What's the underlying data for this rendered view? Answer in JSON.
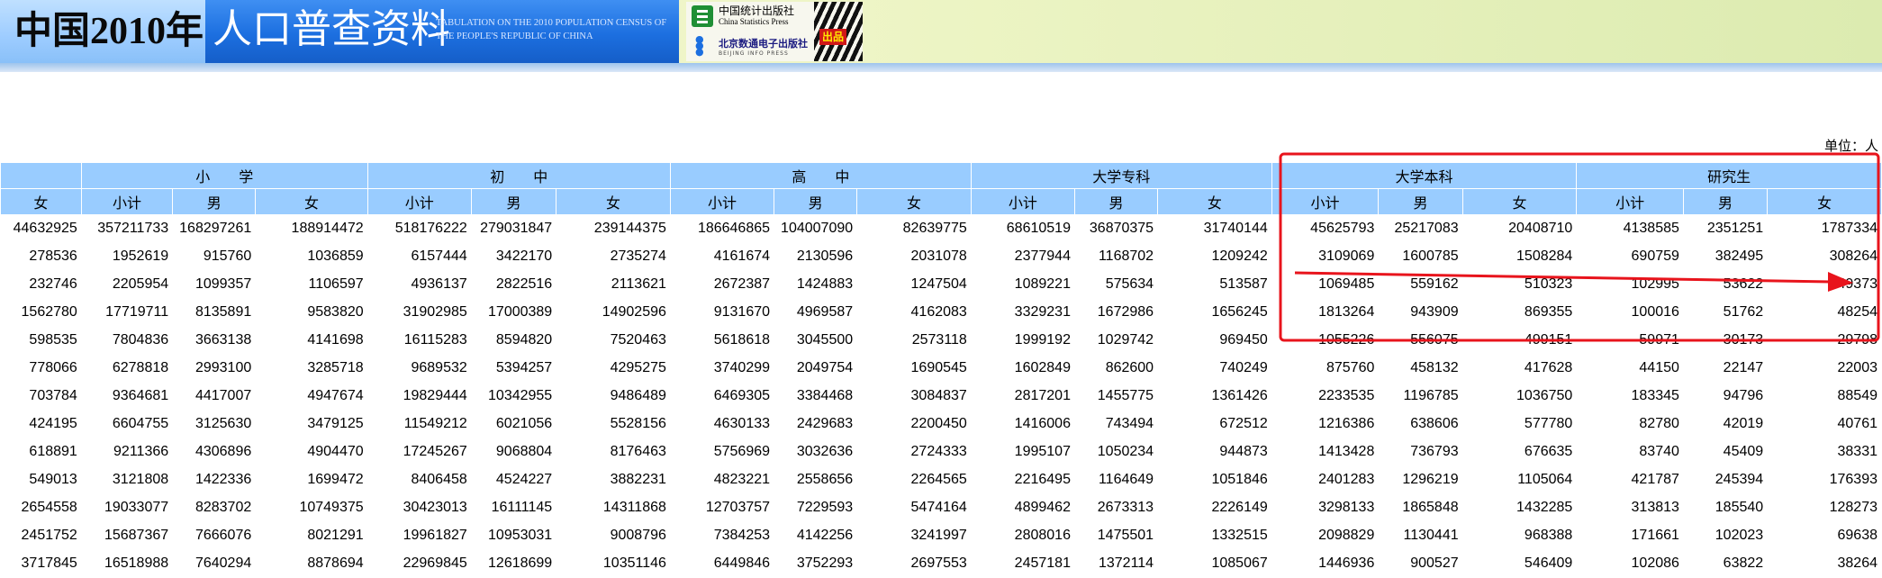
{
  "header": {
    "title_left": "中国2010年",
    "title_main": "人口普查资料",
    "subtitle_line1": "TABULATION ON THE 2010 POPULATION CENSUS OF",
    "subtitle_line2": "THE PEOPLE'S REPUBLIC OF CHINA",
    "logo": {
      "publisher_cn": "中国统计出版社",
      "publisher_en": "China Statistics Press",
      "digital_cn": "北京数通电子出版社",
      "digital_en": "BEIJING INFO PRESS",
      "badge": "出品"
    }
  },
  "unit_label": "单位：人",
  "table": {
    "group_headers": [
      "",
      "小　　学",
      "初　　中",
      "高　　中",
      "大学专科",
      "大学本科",
      "研究生"
    ],
    "sub_headers": [
      "女",
      "小计",
      "男",
      "女",
      "小计",
      "男",
      "女",
      "小计",
      "男",
      "女",
      "小计",
      "男",
      "女",
      "小计",
      "男",
      "女",
      "小计",
      "男",
      "女"
    ],
    "rows": [
      [
        "44632925",
        "357211733",
        "168297261",
        "188914472",
        "518176222",
        "279031847",
        "239144375",
        "186646865",
        "104007090",
        "82639775",
        "68610519",
        "36870375",
        "31740144",
        "45625793",
        "25217083",
        "20408710",
        "4138585",
        "2351251",
        "1787334"
      ],
      [
        "278536",
        "1952619",
        "915760",
        "1036859",
        "6157444",
        "3422170",
        "2735274",
        "4161674",
        "2130596",
        "2031078",
        "2377944",
        "1168702",
        "1209242",
        "3109069",
        "1600785",
        "1508284",
        "690759",
        "382495",
        "308264"
      ],
      [
        "232746",
        "2205954",
        "1099357",
        "1106597",
        "4936137",
        "2822516",
        "2113621",
        "2672387",
        "1424883",
        "1247504",
        "1089221",
        "575634",
        "513587",
        "1069485",
        "559162",
        "510323",
        "102995",
        "53622",
        "49373"
      ],
      [
        "1562780",
        "17719711",
        "8135891",
        "9583820",
        "31902985",
        "17000389",
        "14902596",
        "9131670",
        "4969587",
        "4162083",
        "3329231",
        "1672986",
        "1656245",
        "1813264",
        "943909",
        "869355",
        "100016",
        "51762",
        "48254"
      ],
      [
        "598535",
        "7804836",
        "3663138",
        "4141698",
        "16115283",
        "8594820",
        "7520463",
        "5618618",
        "3045500",
        "2573118",
        "1999192",
        "1029742",
        "969450",
        "1055226",
        "556075",
        "499151",
        "59971",
        "30173",
        "29798"
      ],
      [
        "778066",
        "6278818",
        "2993100",
        "3285718",
        "9689532",
        "5394257",
        "4295275",
        "3740299",
        "2049754",
        "1690545",
        "1602849",
        "862600",
        "740249",
        "875760",
        "458132",
        "417628",
        "44150",
        "22147",
        "22003"
      ],
      [
        "703784",
        "9364681",
        "4417007",
        "4947674",
        "19829444",
        "10342955",
        "9486489",
        "6469305",
        "3384468",
        "3084837",
        "2817201",
        "1455775",
        "1361426",
        "2233535",
        "1196785",
        "1036750",
        "183345",
        "94796",
        "88549"
      ],
      [
        "424195",
        "6604755",
        "3125630",
        "3479125",
        "11549212",
        "6021056",
        "5528156",
        "4630133",
        "2429683",
        "2200450",
        "1416006",
        "743494",
        "672512",
        "1216386",
        "638606",
        "577780",
        "82780",
        "42019",
        "40761"
      ],
      [
        "618891",
        "9211366",
        "4306896",
        "4904470",
        "17245267",
        "9068804",
        "8176463",
        "5756969",
        "3032636",
        "2724333",
        "1995107",
        "1050234",
        "944873",
        "1413428",
        "736793",
        "676635",
        "83740",
        "45409",
        "38331"
      ],
      [
        "549013",
        "3121808",
        "1422336",
        "1699472",
        "8406458",
        "4524227",
        "3882231",
        "4823221",
        "2558656",
        "2264565",
        "2216495",
        "1164649",
        "1051846",
        "2401283",
        "1296219",
        "1105064",
        "421787",
        "245394",
        "176393"
      ],
      [
        "2654558",
        "19033077",
        "8283702",
        "10749375",
        "30423013",
        "16111145",
        "14311868",
        "12703757",
        "7229593",
        "5474164",
        "4899462",
        "2673313",
        "2226149",
        "3298133",
        "1865848",
        "1432285",
        "313813",
        "185540",
        "128273"
      ],
      [
        "2451752",
        "15687367",
        "7666076",
        "8021291",
        "19961827",
        "10953031",
        "9008796",
        "7384253",
        "4142256",
        "3241997",
        "2808016",
        "1475501",
        "1332515",
        "2098829",
        "1130441",
        "968388",
        "171661",
        "102023",
        "69638"
      ],
      [
        "3717845",
        "16518988",
        "7640294",
        "8878694",
        "22969845",
        "12618699",
        "10351146",
        "6449846",
        "3752293",
        "2697553",
        "2457181",
        "1372114",
        "1085067",
        "1446936",
        "900527",
        "546409",
        "102086",
        "63822",
        "38264"
      ]
    ]
  },
  "colors": {
    "table_header_bg": "#99ccff",
    "annotation_red": "#e8141c",
    "banner_blue": "#1c6fe0"
  }
}
